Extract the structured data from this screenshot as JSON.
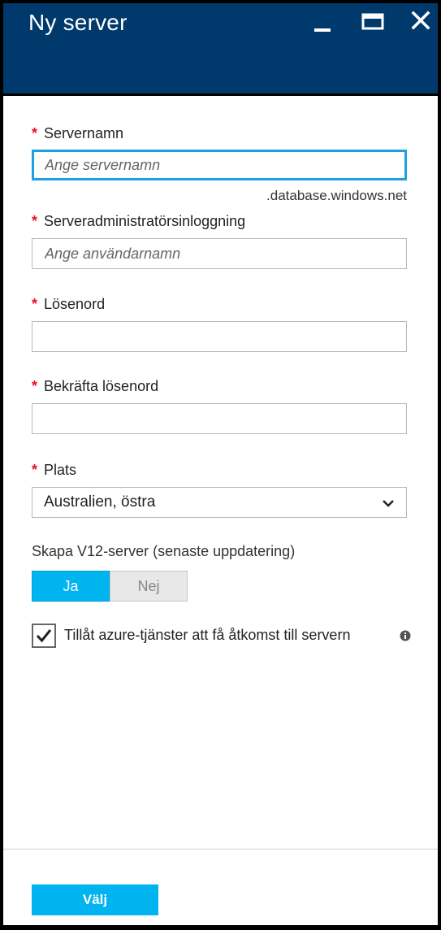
{
  "window": {
    "title": "Ny server",
    "minimize_icon": "minimize-icon",
    "maximize_icon": "maximize-icon",
    "close_icon": "close-icon",
    "title_bar_color": "#003a6c"
  },
  "form": {
    "server_name": {
      "label": "Servernamn",
      "required_marker": "*",
      "placeholder": "Ange servernamn",
      "value": "",
      "suffix": ".database.windows.net"
    },
    "admin_login": {
      "label": "Serveradministratörsinloggning",
      "required_marker": "*",
      "placeholder": "Ange användarnamn",
      "value": ""
    },
    "password": {
      "label": "Lösenord",
      "required_marker": "*",
      "value": ""
    },
    "confirm_password": {
      "label": "Bekräfta lösenord",
      "required_marker": "*",
      "value": ""
    },
    "location": {
      "label": "Plats",
      "required_marker": "*",
      "selected": "Australien, östra",
      "chevron_icon": "chevron-down-icon"
    },
    "v12_server": {
      "label": "Skapa V12-server (senaste uppdatering)",
      "yes_label": "Ja",
      "no_label": "Nej",
      "selected": "Ja"
    },
    "allow_azure": {
      "label": "Tillåt azure-tjänster att få åtkomst till servern",
      "checked": true,
      "info_icon": "info-icon"
    }
  },
  "footer": {
    "select_button_label": "Välj"
  },
  "colors": {
    "accent": "#00b4f0",
    "focus_border": "#1ba1e2",
    "required": "#e81123"
  }
}
